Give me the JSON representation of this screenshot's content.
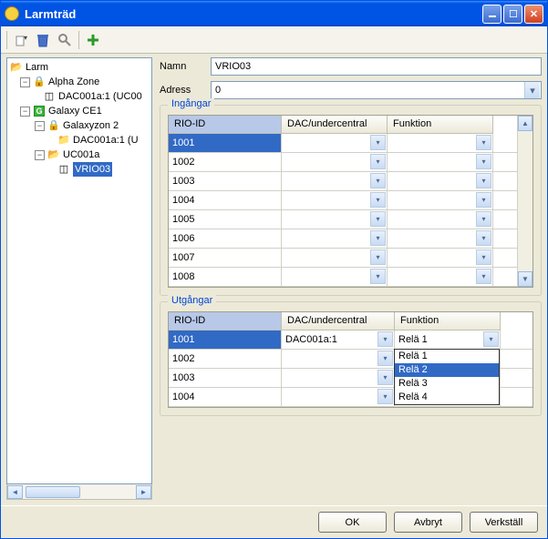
{
  "window": {
    "title": "Larmträd"
  },
  "tree": [
    {
      "label": "Larm"
    },
    {
      "label": "Alpha Zone"
    },
    {
      "label": "DAC001a:1 (UC00"
    },
    {
      "label": "Galaxy CE1"
    },
    {
      "label": "Galaxyzon 2"
    },
    {
      "label": "DAC001a:1 (U"
    },
    {
      "label": "UC001a"
    },
    {
      "label": "VRIO03"
    }
  ],
  "form": {
    "name_label": "Namn",
    "name_value": "VRIO03",
    "address_label": "Adress",
    "address_value": "0"
  },
  "groups": {
    "inputs": {
      "title": "Ingångar",
      "cols": [
        "RIO-ID",
        "DAC/undercentral",
        "Funktion"
      ],
      "rows": [
        {
          "rio": "1001",
          "dac": "",
          "funk": "",
          "selected": true
        },
        {
          "rio": "1002",
          "dac": "",
          "funk": ""
        },
        {
          "rio": "1003",
          "dac": "",
          "funk": ""
        },
        {
          "rio": "1004",
          "dac": "",
          "funk": ""
        },
        {
          "rio": "1005",
          "dac": "",
          "funk": ""
        },
        {
          "rio": "1006",
          "dac": "",
          "funk": ""
        },
        {
          "rio": "1007",
          "dac": "",
          "funk": ""
        },
        {
          "rio": "1008",
          "dac": "",
          "funk": ""
        }
      ]
    },
    "outputs": {
      "title": "Utgångar",
      "cols": [
        "RIO-ID",
        "DAC/undercentral",
        "Funktion"
      ],
      "rows": [
        {
          "rio": "1001",
          "dac": "DAC001a:1",
          "funk": "Relä 1",
          "selected": true,
          "dropdown_open": true
        },
        {
          "rio": "1002",
          "dac": "",
          "funk": ""
        },
        {
          "rio": "1003",
          "dac": "",
          "funk": ""
        },
        {
          "rio": "1004",
          "dac": "",
          "funk": ""
        }
      ],
      "funktion_options": [
        "Relä 1",
        "Relä 2",
        "Relä 3",
        "Relä 4"
      ],
      "funktion_hover_index": 1
    }
  },
  "buttons": {
    "ok": "OK",
    "cancel": "Avbryt",
    "apply": "Verkställ"
  }
}
